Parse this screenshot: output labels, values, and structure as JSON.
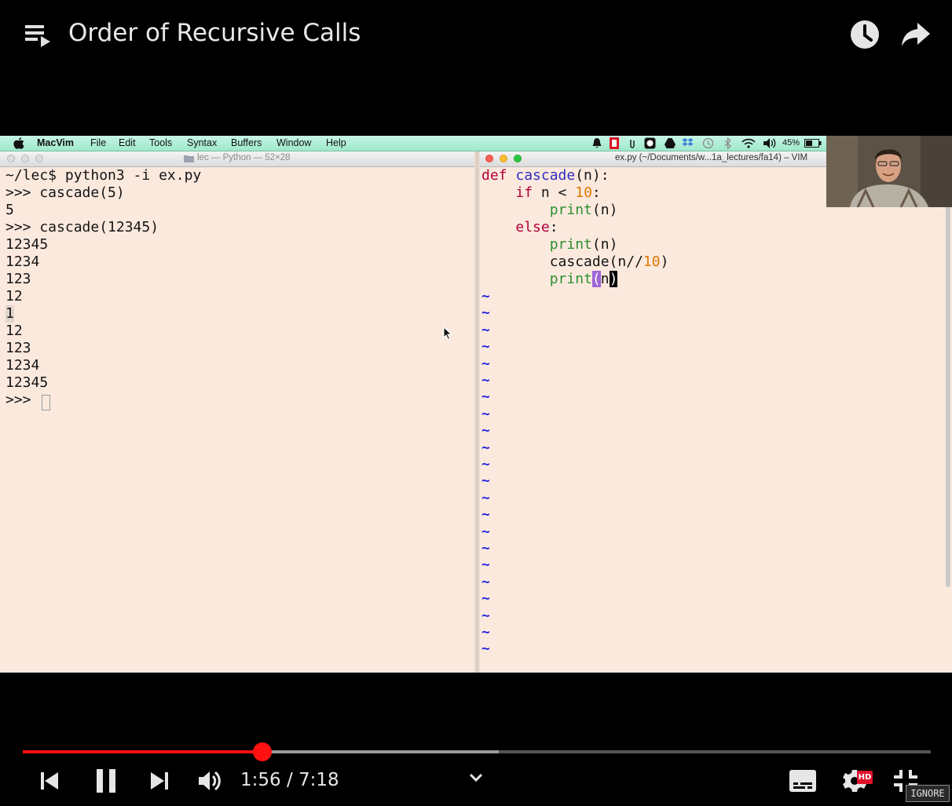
{
  "player": {
    "title": "Order of Recursive Calls",
    "time": "1:56 / 7:18",
    "progress": {
      "played_fraction": 0.264,
      "buffered_fraction": 0.524
    },
    "hd_label": "HD",
    "ignore_label": "IGNORE",
    "accent_color": "#ff1111"
  },
  "mac": {
    "menu": [
      "MacVim",
      "File",
      "Edit",
      "Tools",
      "Syntax",
      "Buffers",
      "Window",
      "Help"
    ],
    "battery": "45%"
  },
  "terminal": {
    "title": "lec — Python — 52×28",
    "lines": [
      "~/lec$ python3 -i ex.py",
      ">>> cascade(5)",
      "5",
      ">>> cascade(12345)",
      "12345",
      "1234",
      "123",
      "12",
      "1",
      "12",
      "123",
      "1234",
      "12345",
      ">>> "
    ]
  },
  "vim": {
    "title": "ex.py (~/Documents/w...1a_lectures/fa14) – VIM",
    "code": {
      "l1_kw": "def",
      "l1_fn": "cascade",
      "l1_rest": "(n):",
      "l2_kw": "if",
      "l2_mid": " n < ",
      "l2_num": "10",
      "l2_end": ":",
      "l3_bi": "print",
      "l3_rest": "(n)",
      "l4_kw": "else",
      "l4_end": ":",
      "l5_bi": "print",
      "l5_rest": "(n)",
      "l6_pre": "cascade(n//",
      "l6_num": "10",
      "l6_end": ")",
      "l7_bi": "print",
      "l7_open": "(",
      "l7_n": "n",
      "l7_close": ")"
    },
    "tilde": "~",
    "tilde_count": 22
  },
  "icons": {
    "playlist": "playlist-icon",
    "watch_later": "clock-icon",
    "share": "share-icon",
    "previous": "previous-icon",
    "pause": "pause-icon",
    "next": "next-icon",
    "volume": "volume-icon",
    "chevron": "chevron-down-icon",
    "subtitles": "subtitles-icon",
    "settings": "gear-icon",
    "exit_fullscreen": "exit-fullscreen-icon"
  }
}
